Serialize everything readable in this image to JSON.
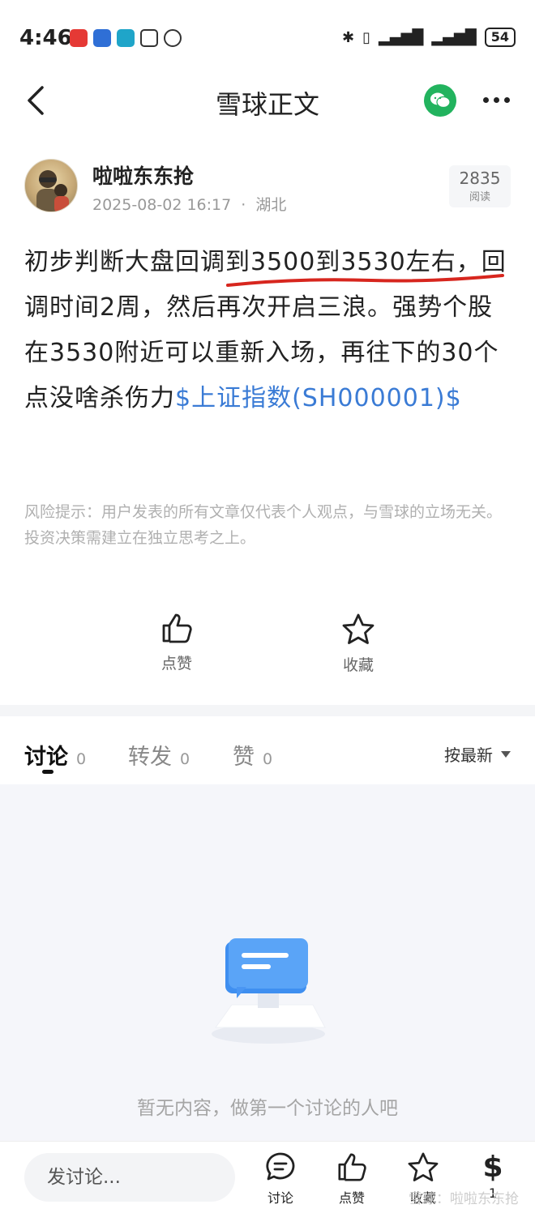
{
  "status": {
    "time": "4:46",
    "battery": "54"
  },
  "nav": {
    "title": "雪球正文"
  },
  "author": {
    "name": "啦啦东东抢",
    "datetime": "2025-08-02 16:17",
    "separator": "·",
    "location": "湖北",
    "read_count": "2835",
    "read_label": "阅读"
  },
  "post": {
    "text_part1": "初步判断大盘回调到3500到3530左右，回调时间2周，然后再次开启三浪。强势个股在3530附近可以重新入场，再往下的30个点没啥杀伤力",
    "stock_link": "$上证指数(SH000001)$"
  },
  "disclaimer": "风险提示：用户发表的所有文章仅代表个人观点，与雪球的立场无关。投资决策需建立在独立思考之上。",
  "actions": {
    "like_label": "点赞",
    "favorite_label": "收藏"
  },
  "tabs": [
    {
      "label": "讨论",
      "count": "0"
    },
    {
      "label": "转发",
      "count": "0"
    },
    {
      "label": "赞",
      "count": "0"
    }
  ],
  "sort_label": "按最新",
  "empty_text": "暂无内容，做第一个讨论的人吧",
  "bottom_bar": {
    "input_placeholder": "发讨论...",
    "discuss_label": "讨论",
    "like_label": "点赞",
    "favorite_label": "收藏",
    "reward_count": "1"
  },
  "watermark": "雪球：啦啦东东抢",
  "colors": {
    "link": "#3a7bd5",
    "wechat": "#22b35e",
    "underline_red": "#d7261e"
  }
}
